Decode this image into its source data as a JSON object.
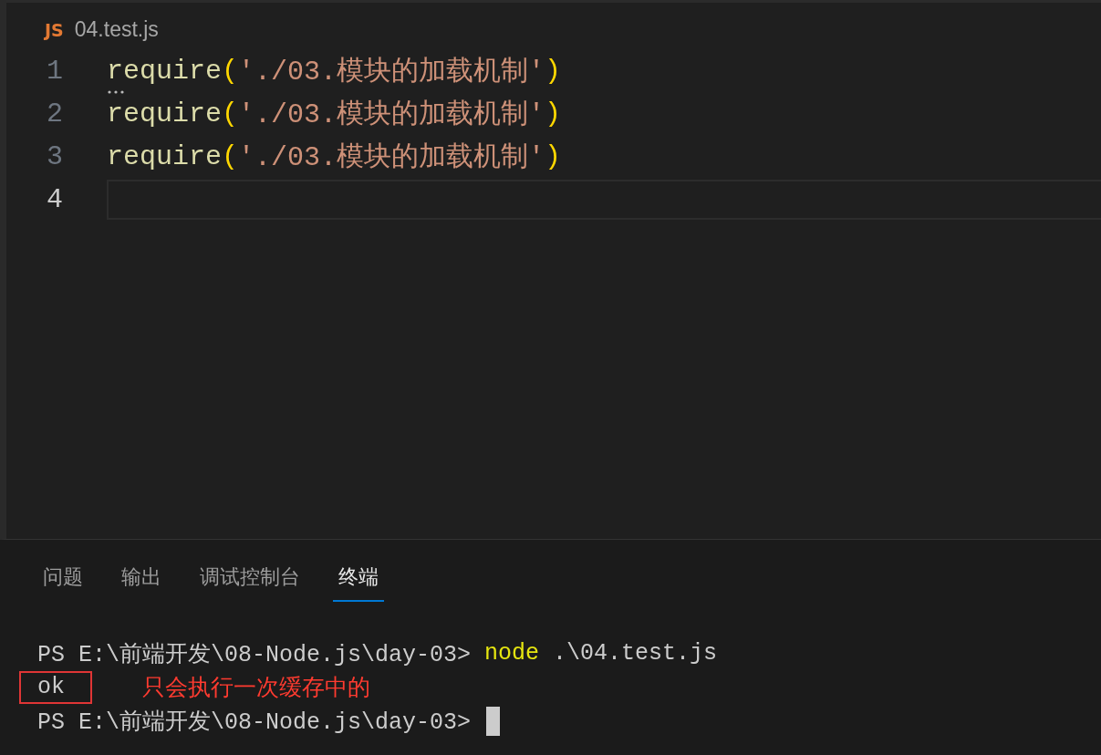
{
  "editor": {
    "file": {
      "badge": "JS",
      "name": "04.test.js"
    },
    "lines": [
      {
        "number": "1",
        "current": false,
        "hint": true,
        "segments": [
          {
            "kind": "fn",
            "text": "require"
          },
          {
            "kind": "paren",
            "text": "("
          },
          {
            "kind": "string",
            "text": "'./03.模块的加载机制'"
          },
          {
            "kind": "paren",
            "text": ")"
          }
        ]
      },
      {
        "number": "2",
        "current": false,
        "hint": false,
        "segments": [
          {
            "kind": "fn",
            "text": "require"
          },
          {
            "kind": "paren",
            "text": "("
          },
          {
            "kind": "string",
            "text": "'./03.模块的加载机制'"
          },
          {
            "kind": "paren",
            "text": ")"
          }
        ]
      },
      {
        "number": "3",
        "current": false,
        "hint": false,
        "segments": [
          {
            "kind": "fn",
            "text": "require"
          },
          {
            "kind": "paren",
            "text": "("
          },
          {
            "kind": "string",
            "text": "'./03.模块的加载机制'"
          },
          {
            "kind": "paren",
            "text": ")"
          }
        ]
      },
      {
        "number": "4",
        "current": true,
        "hint": false
      }
    ]
  },
  "panel": {
    "tabs": [
      {
        "label": "问题",
        "selected": false
      },
      {
        "label": "输出",
        "selected": false
      },
      {
        "label": "调试控制台",
        "selected": false
      },
      {
        "label": "终端",
        "selected": true
      }
    ],
    "terminal": [
      {
        "kind": "prompt",
        "prompt": "PS E:\\前端开发\\08-Node.js\\day-03>",
        "command": "node",
        "args": ".\\04.test.js",
        "cursor": false
      },
      {
        "kind": "output",
        "text": "ok",
        "annotation": "只会执行一次缓存中的"
      },
      {
        "kind": "prompt",
        "prompt": "PS E:\\前端开发\\08-Node.js\\day-03>",
        "cursor": true
      }
    ]
  }
}
